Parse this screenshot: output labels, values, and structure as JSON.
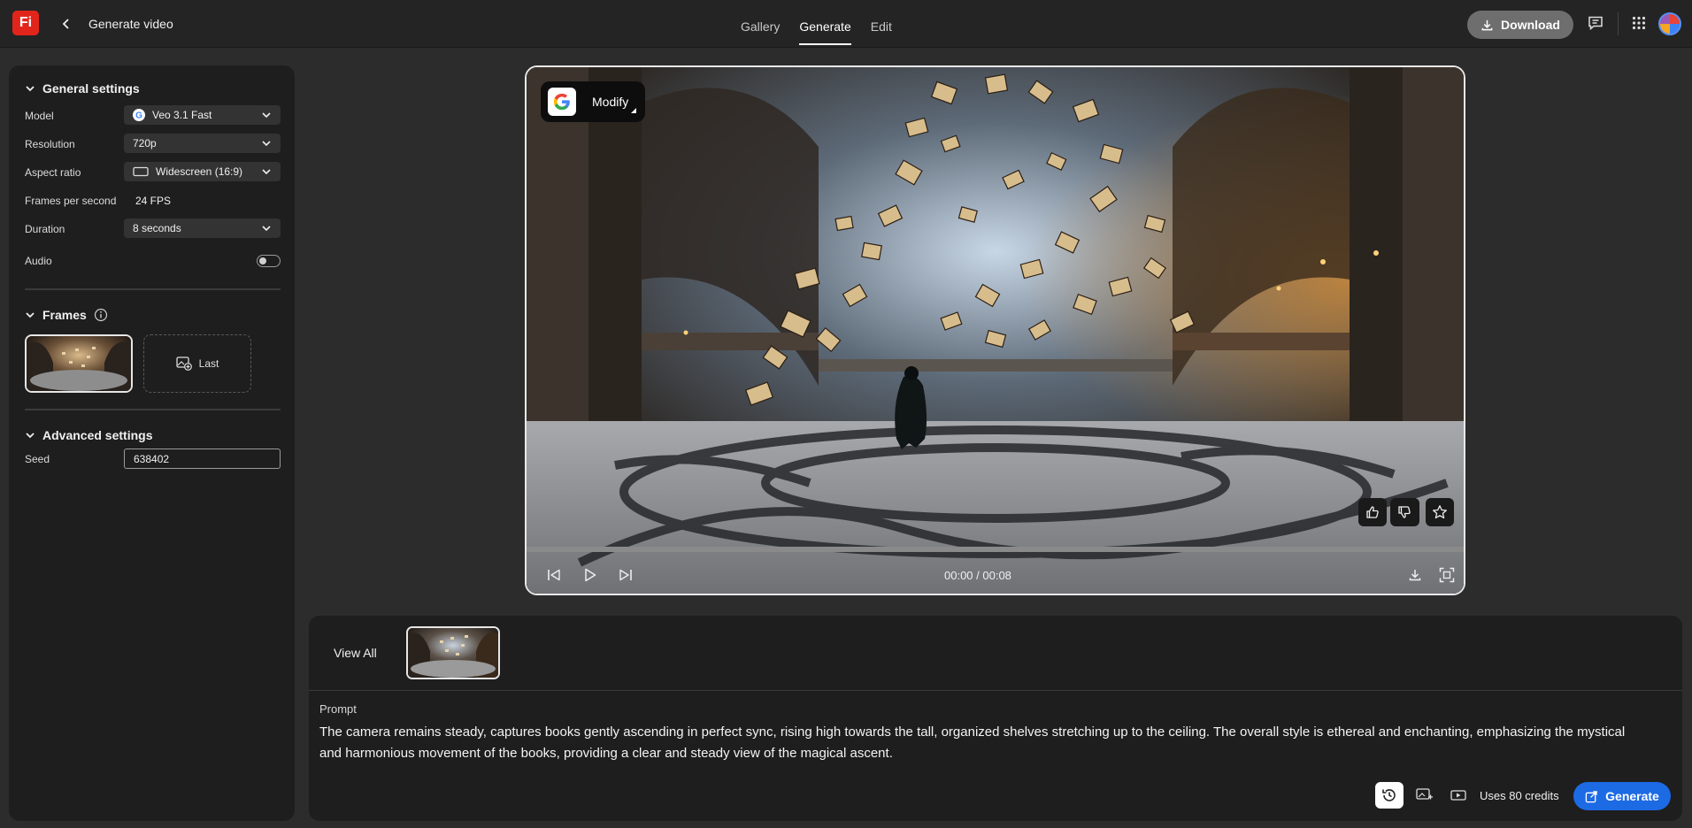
{
  "header": {
    "logo_text": "Fi",
    "title": "Generate video",
    "tabs": [
      {
        "label": "Gallery"
      },
      {
        "label": "Generate"
      },
      {
        "label": "Edit"
      }
    ],
    "download_label": "Download"
  },
  "general_settings": {
    "heading": "General settings",
    "model_label": "Model",
    "model_value": "Veo 3.1 Fast",
    "resolution_label": "Resolution",
    "resolution_value": "720p",
    "aspect_label": "Aspect ratio",
    "aspect_value": "Widescreen (16:9)",
    "fps_label": "Frames per second",
    "fps_value": "24 FPS",
    "duration_label": "Duration",
    "duration_value": "8 seconds",
    "audio_label": "Audio",
    "audio_enabled": false
  },
  "frames": {
    "heading": "Frames",
    "last_label": "Last"
  },
  "advanced_settings": {
    "heading": "Advanced settings",
    "seed_label": "Seed",
    "seed_value": "638402"
  },
  "player": {
    "modify_label": "Modify",
    "timecode": "00:00 / 00:08",
    "progress": 0
  },
  "bottom": {
    "view_all_label": "View All",
    "prompt_label": "Prompt",
    "prompt_text": "The camera remains steady, captures books gently ascending in perfect sync, rising high towards the tall, organized shelves stretching up to the ceiling.  The overall style is ethereal and enchanting, emphasizing the mystical and harmonious movement of the books, providing a clear and steady view of the magical ascent.",
    "credits_label": "Uses 80 credits",
    "generate_label": "Generate"
  },
  "colors": {
    "accent": "#1d6ae5",
    "logo": "#e2251b",
    "background": "#2c2c2c",
    "panel": "#1e1e1e"
  },
  "icons": [
    "chevron-left-icon",
    "download-icon",
    "chat-icon",
    "apps-grid-icon",
    "chevron-down-icon",
    "google-icon",
    "widescreen-icon",
    "info-icon",
    "add-image-icon",
    "thumbs-up-icon",
    "thumbs-down-icon",
    "star-icon",
    "skip-back-icon",
    "play-icon",
    "skip-forward-icon",
    "fullscreen-icon",
    "history-icon",
    "image-settings-icon",
    "video-icon",
    "generate-icon"
  ]
}
